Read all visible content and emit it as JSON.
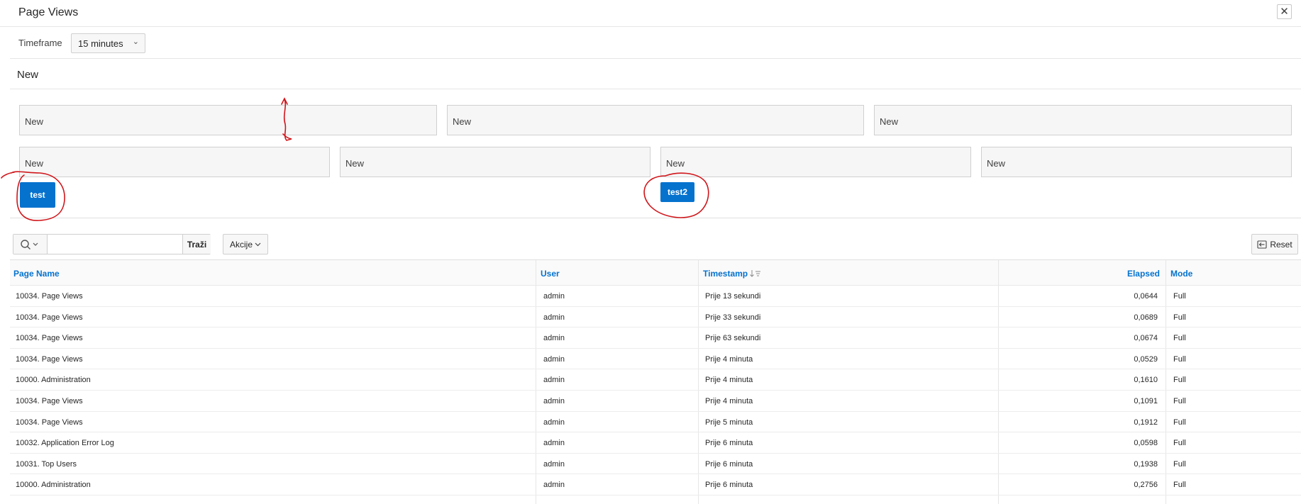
{
  "dialog": {
    "title": "Page Views"
  },
  "timeframe": {
    "label": "Timeframe",
    "value": "15 minutes"
  },
  "region": {
    "title": "New",
    "fields_row1": [
      "New",
      "New",
      "New"
    ],
    "fields_row2": [
      "New",
      "New",
      "New",
      "New"
    ],
    "button1_label": "test",
    "button2_label": "test2"
  },
  "toolbar": {
    "search_button_label": "Traži",
    "actions_label": "Akcije",
    "reset_label": "Reset"
  },
  "table": {
    "columns": [
      "Page Name",
      "User",
      "Timestamp",
      "Elapsed",
      "Mode"
    ],
    "rows": [
      [
        "10034. Page Views",
        "admin",
        "Prije 13 sekundi",
        "0,0644",
        "Full"
      ],
      [
        "10034. Page Views",
        "admin",
        "Prije 33 sekundi",
        "0,0689",
        "Full"
      ],
      [
        "10034. Page Views",
        "admin",
        "Prije 63 sekundi",
        "0,0674",
        "Full"
      ],
      [
        "10034. Page Views",
        "admin",
        "Prije 4 minuta",
        "0,0529",
        "Full"
      ],
      [
        "10000. Administration",
        "admin",
        "Prije 4 minuta",
        "0,1610",
        "Full"
      ],
      [
        "10034. Page Views",
        "admin",
        "Prije 4 minuta",
        "0,1091",
        "Full"
      ],
      [
        "10034. Page Views",
        "admin",
        "Prije 5 minuta",
        "0,1912",
        "Full"
      ],
      [
        "10032. Application Error Log",
        "admin",
        "Prije 6 minuta",
        "0,0598",
        "Full"
      ],
      [
        "10031. Top Users",
        "admin",
        "Prije 6 minuta",
        "0,1938",
        "Full"
      ],
      [
        "10000. Administration",
        "admin",
        "Prije 6 minuta",
        "0,2756",
        "Full"
      ]
    ]
  },
  "colors": {
    "accent": "#0572ce",
    "annotation": "#d0161b"
  }
}
